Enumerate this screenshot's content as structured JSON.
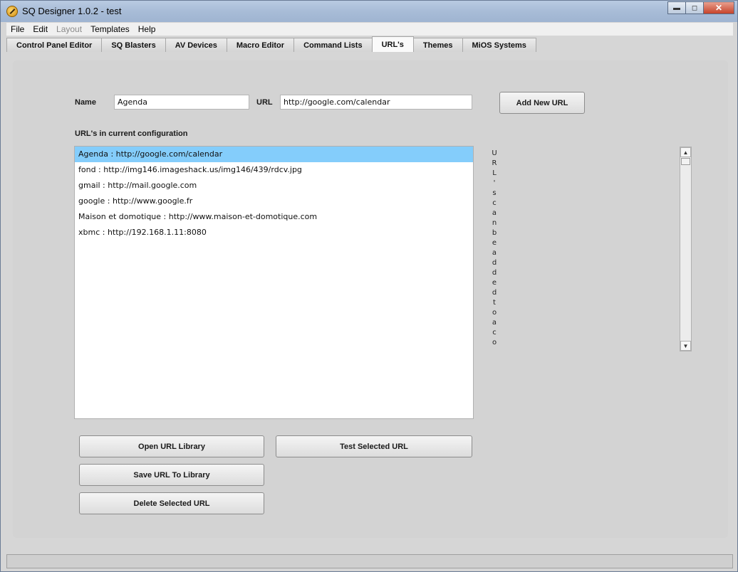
{
  "window": {
    "title": "SQ Designer 1.0.2 - test"
  },
  "menu": [
    "File",
    "Edit",
    "Layout",
    "Templates",
    "Help"
  ],
  "tabs": [
    "Control Panel Editor",
    "SQ Blasters",
    "AV Devices",
    "Macro Editor",
    "Command Lists",
    "URL's",
    "Themes",
    "MiOS Systems"
  ],
  "active_tab": "URL's",
  "form": {
    "name_label": "Name",
    "name_value": "Agenda",
    "url_label": "URL",
    "url_value": "http://google.com/calendar",
    "add_button": "Add New URL"
  },
  "list": {
    "heading": "URL's in current configuration",
    "items": [
      "Agenda : http://google.com/calendar",
      "fond : http://img146.imageshack.us/img146/439/rdcv.jpg",
      "gmail : http://mail.google.com",
      "google : http://www.google.fr",
      "Maison et domotique : http://www.maison-et-domotique.com",
      "xbmc : http://192.168.1.11:8080"
    ],
    "selected_index": 0
  },
  "info_text_chars": [
    "U",
    "R",
    "L",
    "'",
    "s",
    "c",
    "a",
    "n",
    "b",
    "e",
    "a",
    "d",
    "d",
    "e",
    "d",
    "t",
    "o",
    "a",
    "c",
    "o"
  ],
  "buttons": {
    "open_library": "Open URL Library",
    "test_selected": "Test Selected URL",
    "save_to_library": "Save URL To Library",
    "delete_selected": "Delete Selected URL"
  },
  "colors": {
    "selection": "#84cdfb",
    "panel": "#d3d3d3"
  },
  "icons": {
    "app": "pen-icon",
    "minimize": "minimize-icon",
    "maximize": "maximize-icon",
    "close": "close-icon"
  }
}
